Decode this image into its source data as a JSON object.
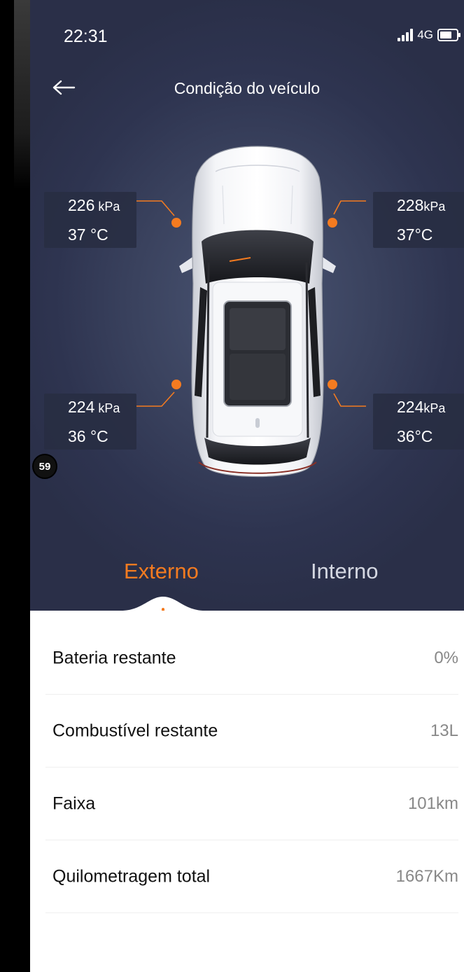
{
  "status_bar": {
    "time": "22:31",
    "network": "4G"
  },
  "nav": {
    "title": "Condição do veículo"
  },
  "overlay_badge": "59",
  "tires": {
    "front_left": {
      "pressure": "226",
      "pressure_unit": " kPa",
      "temp": "37 °C"
    },
    "front_right": {
      "pressure": "228",
      "pressure_unit": "kPa",
      "temp": "37°C"
    },
    "rear_left": {
      "pressure": "224",
      "pressure_unit": " kPa",
      "temp": "36 °C"
    },
    "rear_right": {
      "pressure": "224",
      "pressure_unit": "kPa",
      "temp": "36°C"
    }
  },
  "tabs": {
    "external": "Externo",
    "internal": "Interno"
  },
  "details": [
    {
      "label": "Bateria restante",
      "value": "0%"
    },
    {
      "label": "Combustível restante",
      "value": "13L"
    },
    {
      "label": "Faixa",
      "value": "101km"
    },
    {
      "label": "Quilometragem total",
      "value": "1667Km"
    }
  ],
  "colors": {
    "accent": "#f47b20",
    "hero_bg": "#2e3450",
    "text_light": "#ffffff"
  }
}
